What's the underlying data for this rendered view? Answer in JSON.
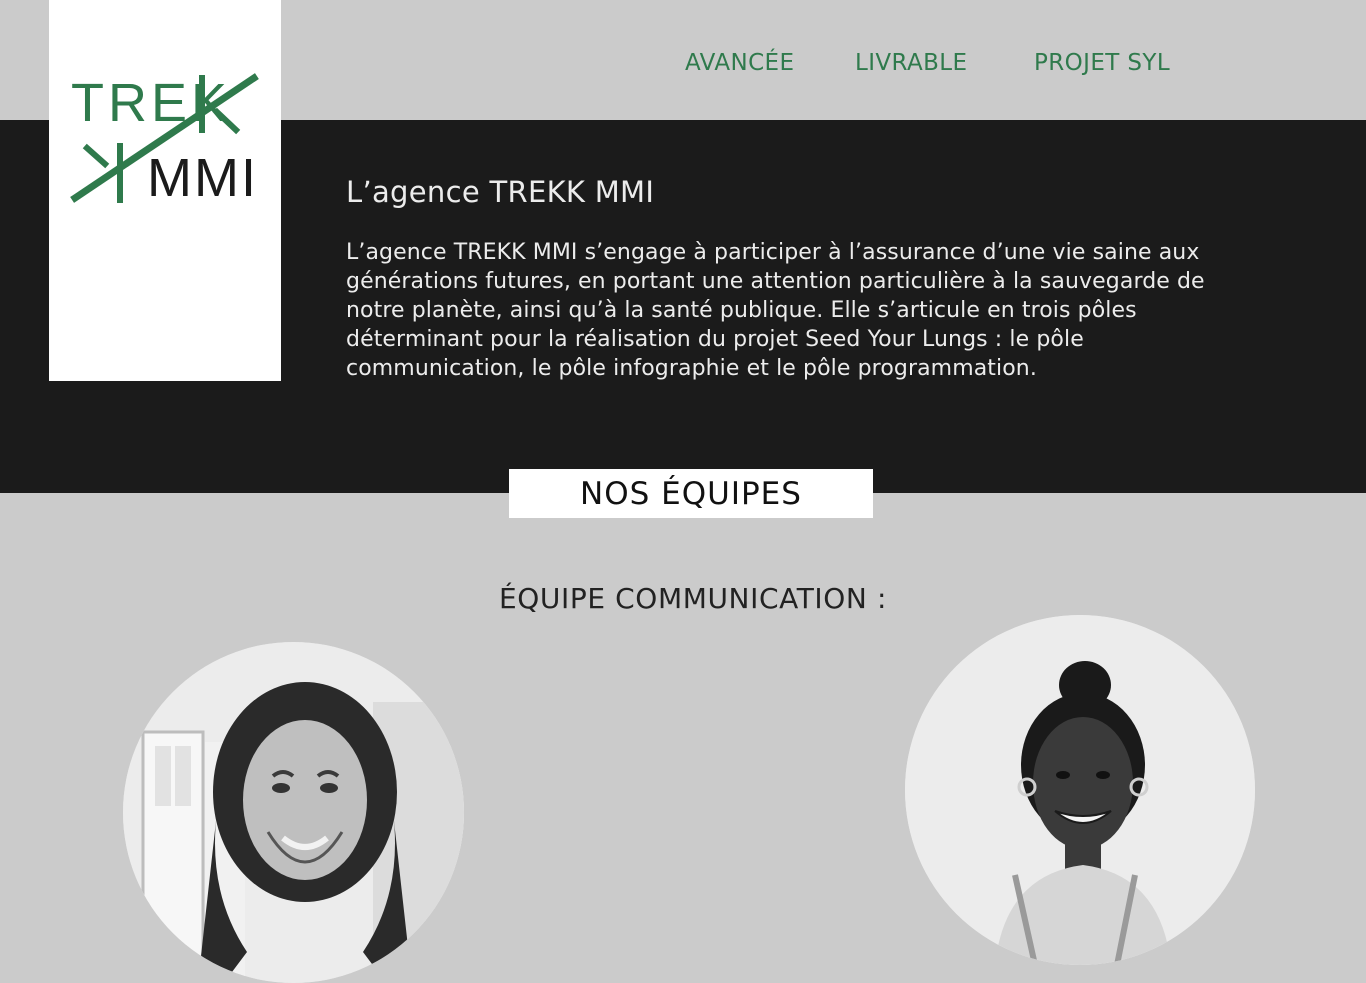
{
  "brand": {
    "logo_line1": "TREK",
    "logo_line2": "MMI",
    "accent_color": "#2f7a4c"
  },
  "nav": {
    "items": [
      {
        "label": "AVANCÉE"
      },
      {
        "label": "LIVRABLE"
      },
      {
        "label": "PROJET SYL"
      }
    ]
  },
  "hero": {
    "title": "L’agence TREKK MMI",
    "description": "L’agence TREKK MMI s’engage à participer à l’assurance d’une vie saine aux générations futures, en portant une attention particulière à la sauvegarde de notre planète, ainsi qu’à la santé publique. Elle s’articule en trois pôles déterminant pour la réalisation du projet Seed Your Lungs : le pôle communication, le pôle infographie et le pôle programmation."
  },
  "teams": {
    "badge": "NOS ÉQUIPES",
    "section_title": "ÉQUIPE COMMUNICATION :"
  },
  "members": [
    {
      "photo": "member-photo-man-long-hair"
    },
    {
      "photo": "member-photo-woman-hair-bun"
    }
  ]
}
